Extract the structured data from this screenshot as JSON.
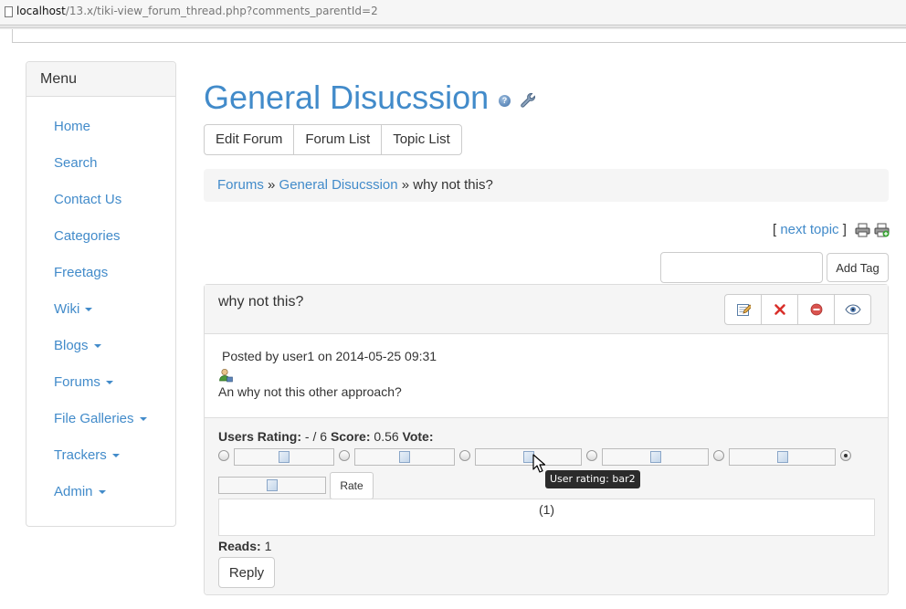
{
  "browser": {
    "url_host": "localhost",
    "url_path": "/13.x/tiki-view_forum_thread.php?comments_parentId=2"
  },
  "menu": {
    "title": "Menu",
    "items": [
      {
        "label": "Home",
        "dropdown": false
      },
      {
        "label": "Search",
        "dropdown": false
      },
      {
        "label": "Contact Us",
        "dropdown": false
      },
      {
        "label": "Categories",
        "dropdown": false
      },
      {
        "label": "Freetags",
        "dropdown": false
      },
      {
        "label": "Wiki",
        "dropdown": true
      },
      {
        "label": "Blogs",
        "dropdown": true
      },
      {
        "label": "Forums",
        "dropdown": true
      },
      {
        "label": "File Galleries",
        "dropdown": true
      },
      {
        "label": "Trackers",
        "dropdown": true
      },
      {
        "label": "Admin",
        "dropdown": true
      }
    ]
  },
  "page": {
    "title": "General Disucssion",
    "help_icon_glyph": "?",
    "buttons": {
      "edit_forum": "Edit Forum",
      "forum_list": "Forum List",
      "topic_list": "Topic List"
    },
    "breadcrumb": {
      "forums": "Forums",
      "separator": "»",
      "forum": "General Disucssion",
      "current": "why not this?"
    },
    "next_topic": {
      "open_bracket": "[",
      "label": "next topic",
      "close_bracket": "]"
    },
    "tag": {
      "input_value": "",
      "add_button": "Add Tag"
    }
  },
  "post": {
    "title": "why not this?",
    "posted_by": "Posted by user1 on 2014-05-25 09:31",
    "body": "An why not this other approach?",
    "actions": [
      "edit-icon",
      "delete-icon",
      "remove-icon",
      "watch-icon"
    ],
    "rating": {
      "users_rating_label": "Users Rating:",
      "users_rating_value": " - / 6 ",
      "score_label": "Score:",
      "score_value": " 0.56 ",
      "vote_label": "Vote:",
      "selected_option": 6,
      "rate_button": "Rate",
      "result": "(1)"
    },
    "reads_label": "Reads:",
    "reads_value": " 1",
    "reply_button": "Reply"
  },
  "tooltip": {
    "text": "User rating: bar2"
  },
  "colors": {
    "link": "#428bca",
    "panel_bg": "#f5f5f5",
    "border": "#dddddd",
    "delete": "#d9302b",
    "remove": "#d9534f"
  }
}
